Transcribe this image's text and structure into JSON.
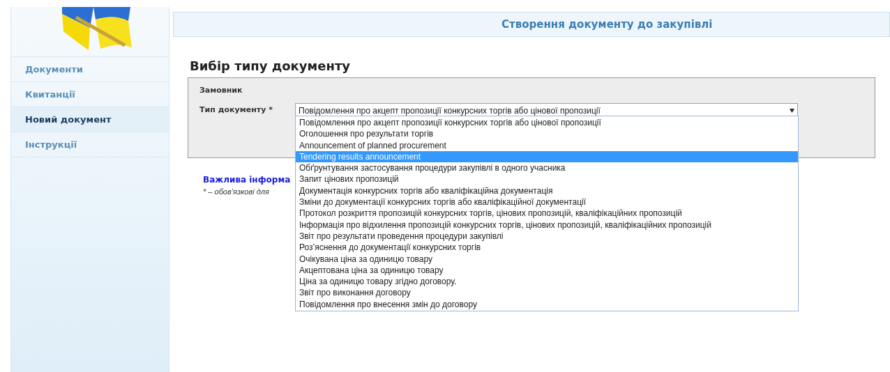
{
  "sidebar": {
    "items": [
      {
        "label": "Документи",
        "selected": false
      },
      {
        "label": "Квитанції",
        "selected": false
      },
      {
        "label": "Новий документ",
        "selected": true
      },
      {
        "label": "Інструкції",
        "selected": false
      }
    ]
  },
  "header": {
    "title": "Створення документу до закупівлі"
  },
  "form": {
    "heading": "Вибір типу документу",
    "customer_label": "Замовник",
    "type_label": "Тип документу *",
    "type_value": "Повідомлення про акцепт пропозиції конкурсних торгів або цінової пропозиції",
    "dropdown_expanded": true,
    "options": [
      {
        "label": "Повідомлення про акцепт пропозиції конкурсних торгів або цінової пропозиції",
        "selected": false
      },
      {
        "label": "Оголошення про результати торгів",
        "selected": false
      },
      {
        "label": "Announcement of planned procurement",
        "selected": false
      },
      {
        "label": "Tendering results announcement",
        "selected": true
      },
      {
        "label": "Обґрунтування застосування процедури закупівлі в одного учасника",
        "selected": false
      },
      {
        "label": "Запит цінових пропозицій",
        "selected": false
      },
      {
        "label": "Документація конкурсних торгів або кваліфікаційна документація",
        "selected": false
      },
      {
        "label": "Зміни до документації конкурсних торгів або кваліфікаційної документації",
        "selected": false
      },
      {
        "label": "Протокол розкриття пропозицій конкурсних торгів, цінових пропозицій, кваліфікаційних пропозицій",
        "selected": false
      },
      {
        "label": "Інформація про відхилення пропозицій конкурсних торгів, цінових пропозицій, кваліфікаційних пропозицій",
        "selected": false
      },
      {
        "label": "Звіт про результати проведення процедури закупівлі",
        "selected": false
      },
      {
        "label": "Роз’яснення до документації конкурсних торгів",
        "selected": false
      },
      {
        "label": "Очікувана ціна за одиницю товару",
        "selected": false
      },
      {
        "label": "Акцептована ціна за одиницю товару",
        "selected": false
      },
      {
        "label": "Ціна за одиницю товару згідно договору.",
        "selected": false
      },
      {
        "label": "Звіт про виконання договору",
        "selected": false
      },
      {
        "label": "Повідомлення про внесення змін до договору",
        "selected": false
      }
    ]
  },
  "notes": {
    "important_link": "Важлива інформа",
    "required_note": "* – обов’язкові для"
  }
}
